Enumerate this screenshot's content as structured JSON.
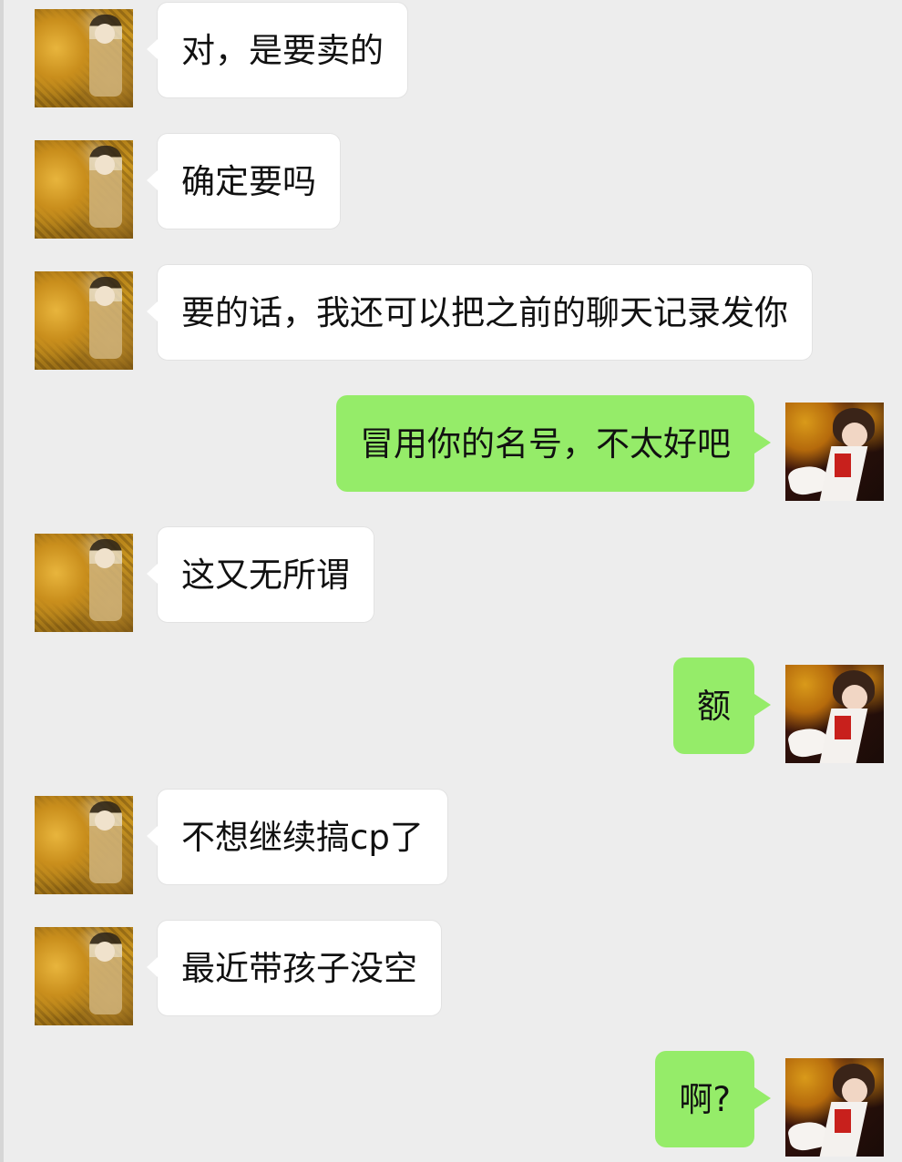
{
  "chat": {
    "messages": [
      {
        "sender": "other",
        "text": "对，是要卖的"
      },
      {
        "sender": "other",
        "text": "确定要吗"
      },
      {
        "sender": "other",
        "text": "要的话，我还可以把之前的聊天记录发你"
      },
      {
        "sender": "self",
        "text": "冒用你的名号，不太好吧"
      },
      {
        "sender": "other",
        "text": "这又无所谓"
      },
      {
        "sender": "self",
        "text": "额"
      },
      {
        "sender": "other",
        "text": "不想继续搞cp了"
      },
      {
        "sender": "other",
        "text": "最近带孩子没空"
      },
      {
        "sender": "self",
        "text": "啊?"
      }
    ]
  },
  "colors": {
    "background": "#ededed",
    "incoming_bubble": "#ffffff",
    "outgoing_bubble": "#95ec69",
    "text": "#111111"
  },
  "avatars": {
    "other": "golden-painting-avatar",
    "self": "maid-costume-avatar"
  }
}
